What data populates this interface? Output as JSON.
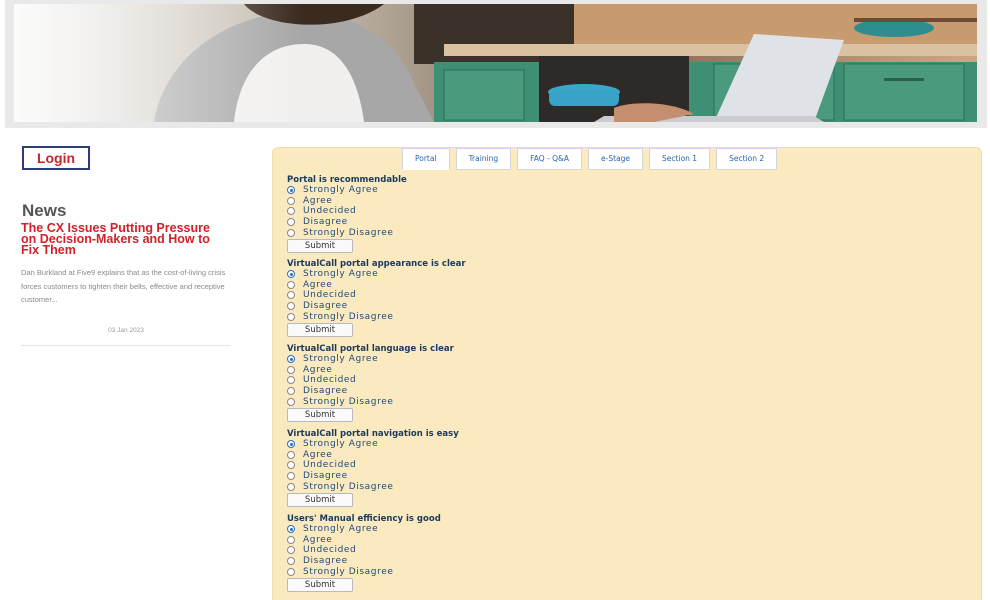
{
  "sidebar": {
    "login_label": "Login",
    "news_heading": "News",
    "news_item": {
      "title": "The CX Issues Putting Pressure on Decision-Makers and How to Fix Them",
      "body": "Dan Burkland at Five9 explains that as the cost-of-living crisis forces customers to tighten their belts, effective and receptive customer...",
      "date": "03 Jan 2023"
    }
  },
  "tabs": [
    {
      "label": "Portal",
      "active": true
    },
    {
      "label": "Training",
      "active": false
    },
    {
      "label": "FAQ - Q&A",
      "active": false
    },
    {
      "label": "e-Stage",
      "active": false
    },
    {
      "label": "Section 1",
      "active": false
    },
    {
      "label": "Section 2",
      "active": false
    }
  ],
  "options": [
    "Strongly Agree",
    "Agree",
    "Undecided",
    "Disagree",
    "Strongly Disagree"
  ],
  "submit_label": "Submit",
  "questions": [
    {
      "title": "Portal is recommendable",
      "selected": "Strongly Agree"
    },
    {
      "title": "VirtualCall portal appearance is clear",
      "selected": "Strongly Agree"
    },
    {
      "title": "VirtualCall portal language is clear",
      "selected": "Strongly Agree"
    },
    {
      "title": "VirtualCall portal navigation is easy",
      "selected": "Strongly Agree"
    },
    {
      "title": "Users' Manual efficiency is good",
      "selected": "Strongly Agree"
    }
  ],
  "colors": {
    "panel_bg": "#fbe9bf",
    "accent_red": "#d4202a",
    "link_blue": "#2b64a8"
  }
}
